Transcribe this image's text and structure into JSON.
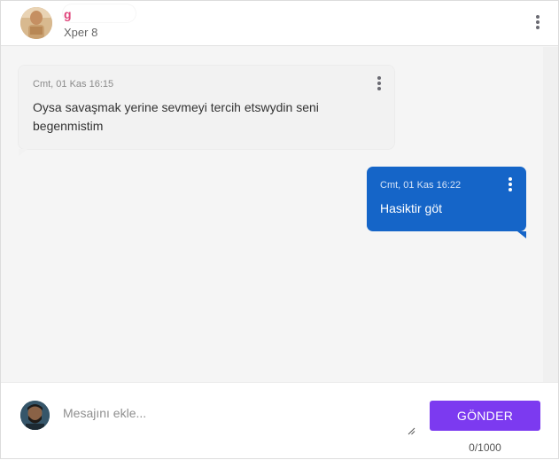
{
  "header": {
    "contact_name": "g",
    "contact_subtitle": "Xper 8",
    "avatar_icon": "user-avatar-icon",
    "menu_icon": "more-vertical-icon"
  },
  "messages": [
    {
      "direction": "incoming",
      "timestamp": "Cmt, 01 Kas 16:15",
      "text": "Oysa savaşmak yerine sevmeyi tercih etswydin seni begenmistim"
    },
    {
      "direction": "outgoing",
      "timestamp": "Cmt, 01 Kas 16:22",
      "text": "Hasiktir göt"
    }
  ],
  "composer": {
    "placeholder": "Mesajını ekle...",
    "value": "",
    "send_label": "GÖNDER",
    "counter": "0/1000"
  },
  "colors": {
    "accent": "#7c3af0",
    "outgoing_bubble": "#1565c8",
    "incoming_bubble": "#f2f2f2",
    "contact_name": "#e0457b"
  }
}
